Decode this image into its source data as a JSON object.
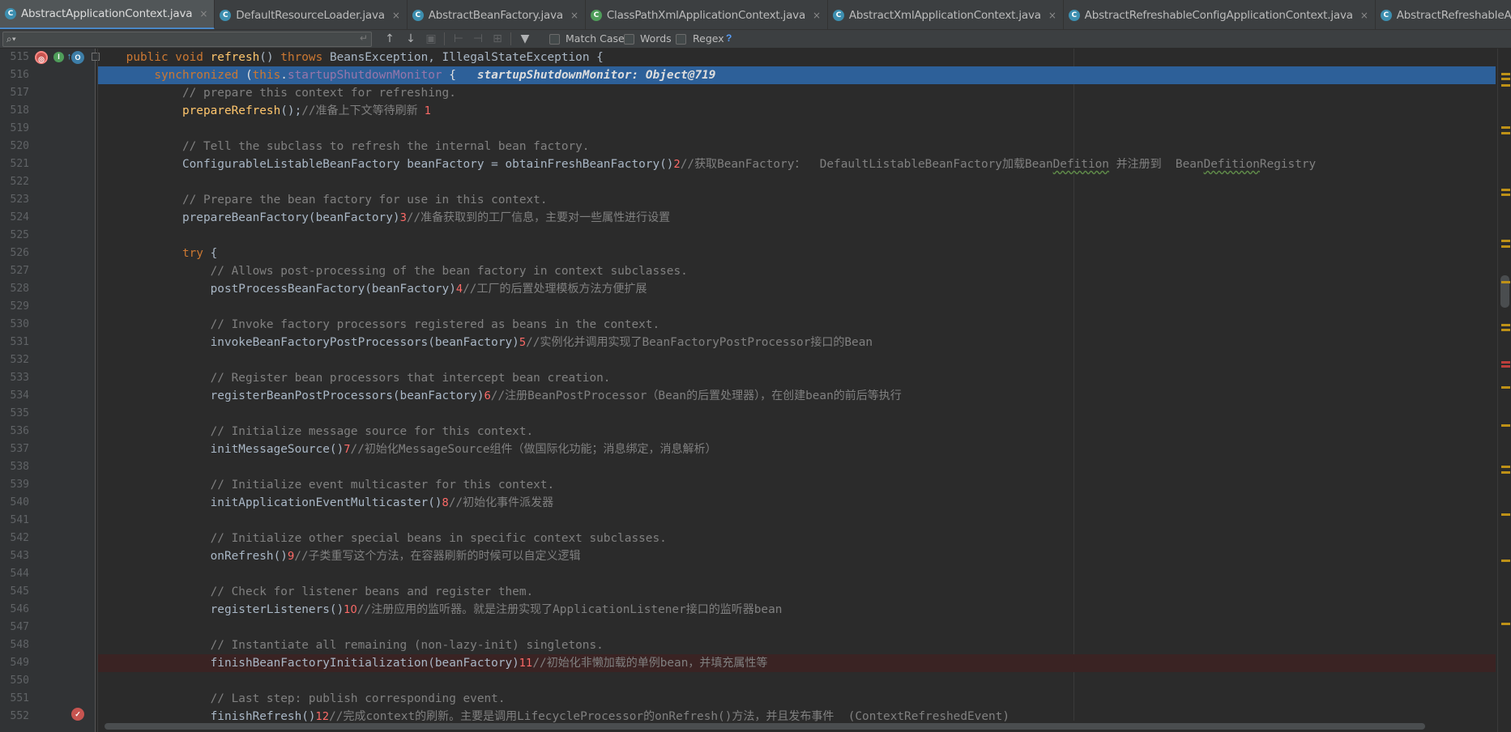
{
  "tabs": [
    {
      "label": "AbstractApplicationContext.java",
      "icon": "class-file-icon",
      "active": true
    },
    {
      "label": "DefaultResourceLoader.java",
      "icon": "class-file-icon",
      "active": false
    },
    {
      "label": "AbstractBeanFactory.java",
      "icon": "class-file-icon",
      "active": false
    },
    {
      "label": "ClassPathXmlApplicationContext.java",
      "icon": "class-file-icon",
      "active": false
    },
    {
      "label": "AbstractXmlApplicationContext.java",
      "icon": "class-file-icon",
      "active": false
    },
    {
      "label": "AbstractRefreshableConfigApplicationContext.java",
      "icon": "class-file-icon",
      "active": false
    },
    {
      "label": "AbstractRefreshableApplicationContext.java",
      "icon": "class-file-icon",
      "active": false
    }
  ],
  "search": {
    "value": "",
    "placeholder": "",
    "match_case": "Match Case",
    "words": "Words",
    "regex": "Regex",
    "help": "?"
  },
  "lines": [
    {
      "n": "515",
      "segs": [
        [
          "",
          "    "
        ],
        [
          "kw",
          "public void "
        ],
        [
          "fn",
          "refresh"
        ],
        [
          "",
          "() "
        ],
        [
          "kw",
          "throws "
        ],
        [
          "",
          "BeansException, IllegalStateException {"
        ]
      ]
    },
    {
      "n": "516",
      "hl": true,
      "segs": [
        [
          "",
          "        "
        ],
        [
          "kw",
          "synchronized "
        ],
        [
          "",
          "("
        ],
        [
          "kw",
          "this"
        ],
        [
          "",
          "."
        ],
        [
          "fld",
          "startupShutdownMonitor"
        ],
        [
          "",
          " {   "
        ],
        [
          "inl",
          "startupShutdownMonitor: Object@719"
        ]
      ]
    },
    {
      "n": "517",
      "segs": [
        [
          "cm",
          "            // prepare this context for refreshing."
        ]
      ]
    },
    {
      "n": "518",
      "segs": [
        [
          "",
          "            "
        ],
        [
          "fn",
          "prepareRefresh"
        ],
        [
          "",
          "();"
        ],
        [
          "cm",
          "//"
        ],
        [
          "cm cn",
          "准备上下文等待刷新"
        ],
        [
          "",
          ""
        ],
        [
          "anno",
          "  1"
        ]
      ]
    },
    {
      "n": "519",
      "segs": [
        [
          "",
          ""
        ]
      ]
    },
    {
      "n": "520",
      "segs": [
        [
          "cm",
          "            // Tell the subclass to refresh the internal bean factory."
        ]
      ]
    },
    {
      "n": "521",
      "segs": [
        [
          "",
          "            ConfigurableListableBeanFactory beanFactory = obtainFreshBeanFactory()"
        ],
        [
          "anno",
          "2"
        ],
        [
          "cm",
          "//"
        ],
        [
          "cm cn",
          "获取"
        ],
        [
          "cm",
          "BeanFactory"
        ],
        [
          "cm cn",
          "："
        ],
        [
          "cm",
          "  DefaultListableBeanFactory"
        ],
        [
          "cm cn",
          "加载"
        ],
        [
          "cm",
          "Bean"
        ],
        [
          "cm ul",
          "Defition"
        ],
        [
          "cm",
          " "
        ],
        [
          "cm cn",
          "并注册到"
        ],
        [
          "cm",
          "  Bean"
        ],
        [
          "cm ul",
          "Defition"
        ],
        [
          "cm",
          "Registry"
        ]
      ]
    },
    {
      "n": "522",
      "segs": [
        [
          "",
          ""
        ]
      ]
    },
    {
      "n": "523",
      "segs": [
        [
          "cm",
          "            // Prepare the bean factory for use in this context."
        ]
      ]
    },
    {
      "n": "524",
      "segs": [
        [
          "",
          "            prepareBeanFactory(beanFactory)"
        ],
        [
          "anno",
          "3"
        ],
        [
          "cm",
          "//"
        ],
        [
          "cm cn",
          "准备获取到的工厂信息，主要对一些属性进行设置"
        ]
      ]
    },
    {
      "n": "525",
      "segs": [
        [
          "",
          ""
        ]
      ]
    },
    {
      "n": "526",
      "segs": [
        [
          "",
          "            "
        ],
        [
          "kw",
          "try "
        ],
        [
          "",
          "{"
        ]
      ]
    },
    {
      "n": "527",
      "segs": [
        [
          "cm",
          "                // Allows post-processing of the bean factory in context subclasses."
        ]
      ]
    },
    {
      "n": "528",
      "segs": [
        [
          "",
          "                postProcessBeanFactory(beanFactory)"
        ],
        [
          "anno",
          "4"
        ],
        [
          "cm",
          "//"
        ],
        [
          "cm cn",
          "工厂的后置处理模板方法方便扩展"
        ]
      ]
    },
    {
      "n": "529",
      "segs": [
        [
          "",
          ""
        ]
      ]
    },
    {
      "n": "530",
      "segs": [
        [
          "cm",
          "                // Invoke factory processors registered as beans in the context."
        ]
      ]
    },
    {
      "n": "531",
      "segs": [
        [
          "",
          "                invokeBeanFactoryPostProcessors(beanFactory)"
        ],
        [
          "anno",
          "5"
        ],
        [
          "cm",
          "//"
        ],
        [
          "cm cn",
          "实例化并调用实现了"
        ],
        [
          "cm",
          "BeanFactoryPostProcessor"
        ],
        [
          "cm cn",
          "接口的"
        ],
        [
          "cm",
          "Bean"
        ]
      ]
    },
    {
      "n": "532",
      "segs": [
        [
          "",
          ""
        ]
      ]
    },
    {
      "n": "533",
      "segs": [
        [
          "cm",
          "                // Register bean processors that intercept bean creation."
        ]
      ]
    },
    {
      "n": "534",
      "segs": [
        [
          "",
          "                registerBeanPostProcessors(beanFactory)"
        ],
        [
          "anno",
          "6"
        ],
        [
          "cm",
          "//"
        ],
        [
          "cm cn",
          "注册"
        ],
        [
          "cm",
          "BeanPostProcessor"
        ],
        [
          "cm cn",
          "（"
        ],
        [
          "cm",
          "Bean"
        ],
        [
          "cm cn",
          "的后置处理器），在创建"
        ],
        [
          "cm",
          "bean"
        ],
        [
          "cm cn",
          "的前后等执行"
        ]
      ]
    },
    {
      "n": "535",
      "segs": [
        [
          "",
          ""
        ]
      ]
    },
    {
      "n": "536",
      "segs": [
        [
          "cm",
          "                // Initialize message source for this context."
        ]
      ]
    },
    {
      "n": "537",
      "segs": [
        [
          "",
          "                initMessageSource()"
        ],
        [
          "anno",
          "7"
        ],
        [
          "cm",
          "//"
        ],
        [
          "cm cn",
          "初始化"
        ],
        [
          "cm",
          "MessageSource"
        ],
        [
          "cm cn",
          "组件（做国际化功能；消息绑定，消息解析）"
        ]
      ]
    },
    {
      "n": "538",
      "segs": [
        [
          "",
          ""
        ]
      ]
    },
    {
      "n": "539",
      "segs": [
        [
          "cm",
          "                // Initialize event multicaster for this context."
        ]
      ]
    },
    {
      "n": "540",
      "segs": [
        [
          "",
          "                initApplicationEventMulticaster()"
        ],
        [
          "anno",
          "8"
        ],
        [
          "cm",
          "//"
        ],
        [
          "cm cn",
          "初始化事件派发器"
        ]
      ]
    },
    {
      "n": "541",
      "segs": [
        [
          "",
          ""
        ]
      ]
    },
    {
      "n": "542",
      "segs": [
        [
          "cm",
          "                // Initialize other special beans in specific context subclasses."
        ]
      ]
    },
    {
      "n": "543",
      "segs": [
        [
          "",
          "                onRefresh()"
        ],
        [
          "anno",
          "9"
        ],
        [
          "cm",
          "//"
        ],
        [
          "cm cn",
          "子类重写这个方法，在容器刷新的时候可以自定义逻辑"
        ]
      ]
    },
    {
      "n": "544",
      "segs": [
        [
          "",
          ""
        ]
      ]
    },
    {
      "n": "545",
      "segs": [
        [
          "cm",
          "                // Check for listener beans and register them."
        ]
      ]
    },
    {
      "n": "546",
      "segs": [
        [
          "",
          "                registerListeners()"
        ],
        [
          "anno",
          "10"
        ],
        [
          "cm",
          "//"
        ],
        [
          "cm cn",
          "注册应用的监听器。就是注册实现了"
        ],
        [
          "cm",
          "ApplicationListener"
        ],
        [
          "cm cn",
          "接口的监听器"
        ],
        [
          "cm",
          "bean"
        ]
      ]
    },
    {
      "n": "547",
      "segs": [
        [
          "",
          ""
        ]
      ]
    },
    {
      "n": "548",
      "segs": [
        [
          "cm",
          "                // Instantiate all remaining (non-lazy-init) singletons."
        ]
      ]
    },
    {
      "n": "549",
      "bp": true,
      "segs": [
        [
          "",
          "                finishBeanFactoryInitialization(beanFactory)"
        ],
        [
          "anno",
          "11"
        ],
        [
          "cm",
          "//"
        ],
        [
          "cm cn",
          "初始化非懒加载的单例"
        ],
        [
          "cm",
          "bean"
        ],
        [
          "cm cn",
          "，并填充属性等"
        ]
      ]
    },
    {
      "n": "550",
      "segs": [
        [
          "",
          ""
        ]
      ]
    },
    {
      "n": "551",
      "segs": [
        [
          "cm",
          "                // Last step: publish corresponding event."
        ]
      ]
    },
    {
      "n": "552",
      "segs": [
        [
          "",
          "                finishRefresh()"
        ],
        [
          "anno",
          "12"
        ],
        [
          "cm",
          "//"
        ],
        [
          "cm cn",
          "完成"
        ],
        [
          "cm",
          "context"
        ],
        [
          "cm cn",
          "的刷新。主要是调用"
        ],
        [
          "cm",
          "LifecycleProcessor"
        ],
        [
          "cm cn",
          "的"
        ],
        [
          "cm",
          "onRefresh()"
        ],
        [
          "cm cn",
          "方法，并且发布事件"
        ],
        [
          "cm",
          "  ("
        ],
        [
          "cm",
          "ContextRefreshedEvent"
        ],
        [
          "cm",
          ")"
        ]
      ]
    }
  ],
  "scroll_marks": [
    {
      "y": 0.035,
      "color": "#be9117"
    },
    {
      "y": 0.043,
      "color": "#be9117"
    },
    {
      "y": 0.052,
      "color": "#be9117"
    },
    {
      "y": 0.114,
      "color": "#be9117"
    },
    {
      "y": 0.122,
      "color": "#be9117"
    },
    {
      "y": 0.205,
      "color": "#be9117"
    },
    {
      "y": 0.212,
      "color": "#be9117"
    },
    {
      "y": 0.28,
      "color": "#be9117"
    },
    {
      "y": 0.288,
      "color": "#be9117"
    },
    {
      "y": 0.34,
      "color": "#be9117"
    },
    {
      "y": 0.403,
      "color": "#be9117"
    },
    {
      "y": 0.41,
      "color": "#be9117"
    },
    {
      "y": 0.457,
      "color": "#bc3f3c"
    },
    {
      "y": 0.463,
      "color": "#bc3f3c"
    },
    {
      "y": 0.494,
      "color": "#be9117"
    },
    {
      "y": 0.55,
      "color": "#be9117"
    },
    {
      "y": 0.61,
      "color": "#be9117"
    },
    {
      "y": 0.618,
      "color": "#be9117"
    },
    {
      "y": 0.68,
      "color": "#be9117"
    },
    {
      "y": 0.748,
      "color": "#be9117"
    },
    {
      "y": 0.84,
      "color": "#be9117"
    }
  ]
}
